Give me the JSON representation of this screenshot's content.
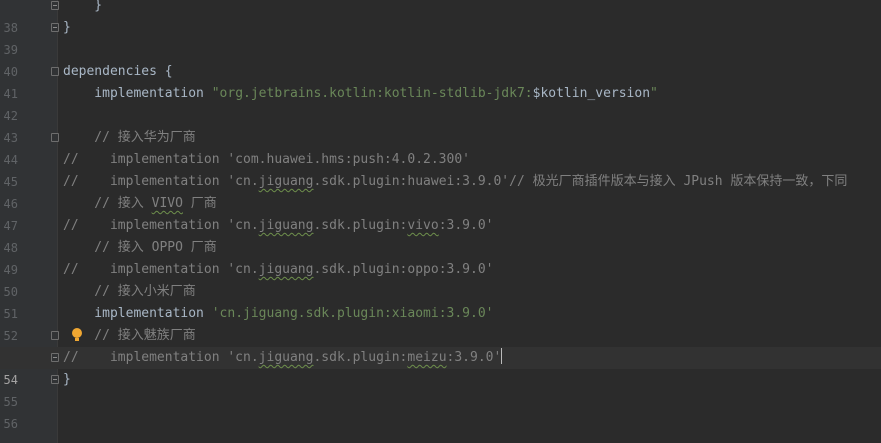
{
  "editor": {
    "lines": [
      {
        "num": "38",
        "text": "    }"
      },
      {
        "num": "39",
        "text": "}"
      },
      {
        "num": "40",
        "text": ""
      },
      {
        "num": "41",
        "text": "dependencies {"
      },
      {
        "num": "42",
        "prefix": "    implementation ",
        "str": "\"org.jetbrains.kotlin:kotlin-stdlib-jdk7:",
        "tmpl": "$kotlin_version",
        "str_end": "\""
      },
      {
        "num": "43",
        "text": ""
      },
      {
        "num": "44",
        "text": "    // 接入华为厂商"
      },
      {
        "num": "45",
        "text": "//    implementation 'com.huawei.hms:push:4.0.2.300'"
      },
      {
        "num": "46",
        "a": "//    implementation 'cn.",
        "b": "jiguang",
        "c": ".sdk.plugin:huawei:3.9.0'// 极光厂商插件版本与接入 JPush 版本保持一致，下同"
      },
      {
        "num": "47",
        "a": "    // 接入 ",
        "b": "VIVO",
        "c": " 厂商"
      },
      {
        "num": "48",
        "a": "//    implementation 'cn.",
        "b": "jiguang",
        "c": ".sdk.plugin:",
        "d": "vivo",
        "e": ":3.9.0'"
      },
      {
        "num": "49",
        "text": "    // 接入 OPPO 厂商"
      },
      {
        "num": "50",
        "a": "//    implementation 'cn.",
        "b": "jiguang",
        "c": ".sdk.plugin:oppo:3.9.0'"
      },
      {
        "num": "51",
        "text": "    // 接入小米厂商"
      },
      {
        "num": "52",
        "prefix": "    implementation ",
        "str": "'cn.jiguang.sdk.plugin:xiaomi:3.9.0'"
      },
      {
        "num": "53",
        "text": "    // 接入魅族厂商"
      },
      {
        "num": "54",
        "a": "//    implementation 'cn.",
        "b": "jiguang",
        "c": ".sdk.plugin:",
        "d": "meizu",
        "e": ":3.9.0'"
      },
      {
        "num": "55",
        "text": "}"
      },
      {
        "num": "56",
        "text": ""
      }
    ]
  },
  "colors": {
    "background": "#2b2b2b",
    "gutter": "#313335",
    "keyword": "#cc7832",
    "string": "#6a8759",
    "comment": "#808080",
    "text": "#a9b7c6",
    "intention_bulb": "#f0a732"
  },
  "icons": {
    "fold": "fold-marker-icon",
    "bulb": "intention-bulb-icon"
  }
}
